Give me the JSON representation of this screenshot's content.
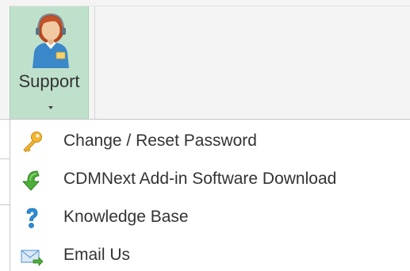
{
  "ribbon": {
    "support_button": {
      "label": "Support",
      "icon": "support-agent-icon",
      "has_dropdown": true,
      "background_color": "#bfe1cc"
    }
  },
  "menu": {
    "items": [
      {
        "label": "Change / Reset Password",
        "icon": "key-icon"
      },
      {
        "label": "CDMNext Add-in Software Download",
        "icon": "download-arrow-icon"
      },
      {
        "label": "Knowledge Base",
        "icon": "question-mark-icon"
      },
      {
        "label": "Email Us",
        "icon": "email-envelope-icon"
      }
    ]
  },
  "colors": {
    "text": "#333333",
    "key_gold": "#e8a31c",
    "download_green": "#4caf3a",
    "help_blue": "#2a8fd8",
    "mail_blue": "#4a90c8"
  }
}
